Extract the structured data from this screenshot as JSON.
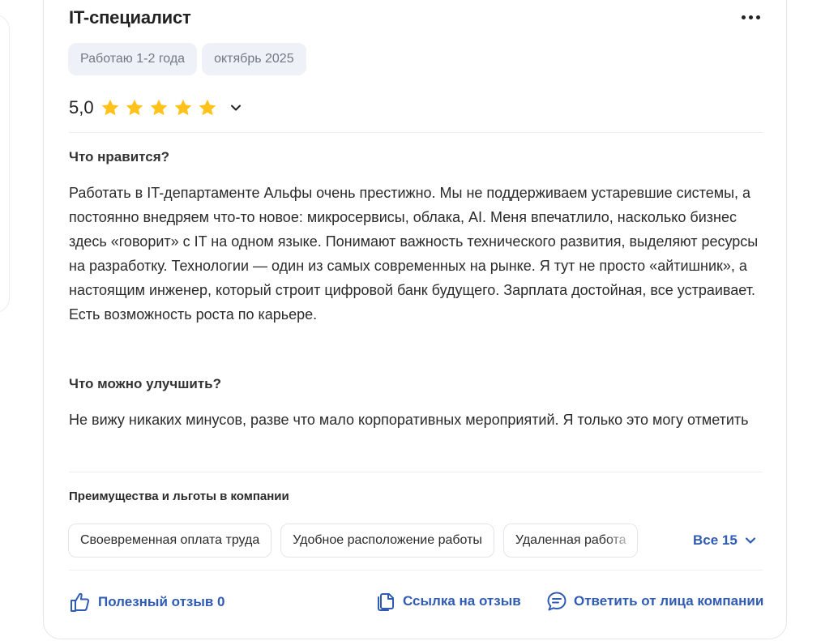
{
  "review": {
    "title": "IT-специалист",
    "tags": [
      "Работаю 1-2 года",
      "октябрь 2025"
    ],
    "rating_value": "5,0",
    "rating_stars": 5,
    "likes_title": "Что нравится?",
    "likes_text": "Работать в IT-департаменте Альфы очень престижно. Мы не поддерживаем устаревшие системы, а постоянно внедряем что-то новое: микросервисы, облака, AI. Меня впечатлило, насколько бизнес здесь «говорит» с IT на одном языке. Понимают важность технического развития, выделяют ресурсы на разработку. Технологии — один из самых современных на рынке. Я тут не просто «айтишник», а настоящим инженер, который строит цифровой банк будущего. Зарплата достойная, все устраивает. Есть возможность роста по карьере.",
    "improve_title": "Что можно улучшить?",
    "improve_text": "Не вижу никаких минусов, разве что мало корпоративных мероприятий. Я только это могу отметить"
  },
  "benefits": {
    "title": "Преимущества и льготы в компании",
    "chips": [
      "Своевременная оплата труда",
      "Удобное расположение работы",
      "Удаленная работа"
    ],
    "all_label": "Все 15"
  },
  "actions": {
    "helpful": "Полезный отзыв 0",
    "link": "Ссылка на отзыв",
    "reply": "Ответить от лица компании"
  },
  "colors": {
    "accent": "#2f5bb3",
    "star": "#ffc21a",
    "tag_bg": "#eef1f7"
  }
}
